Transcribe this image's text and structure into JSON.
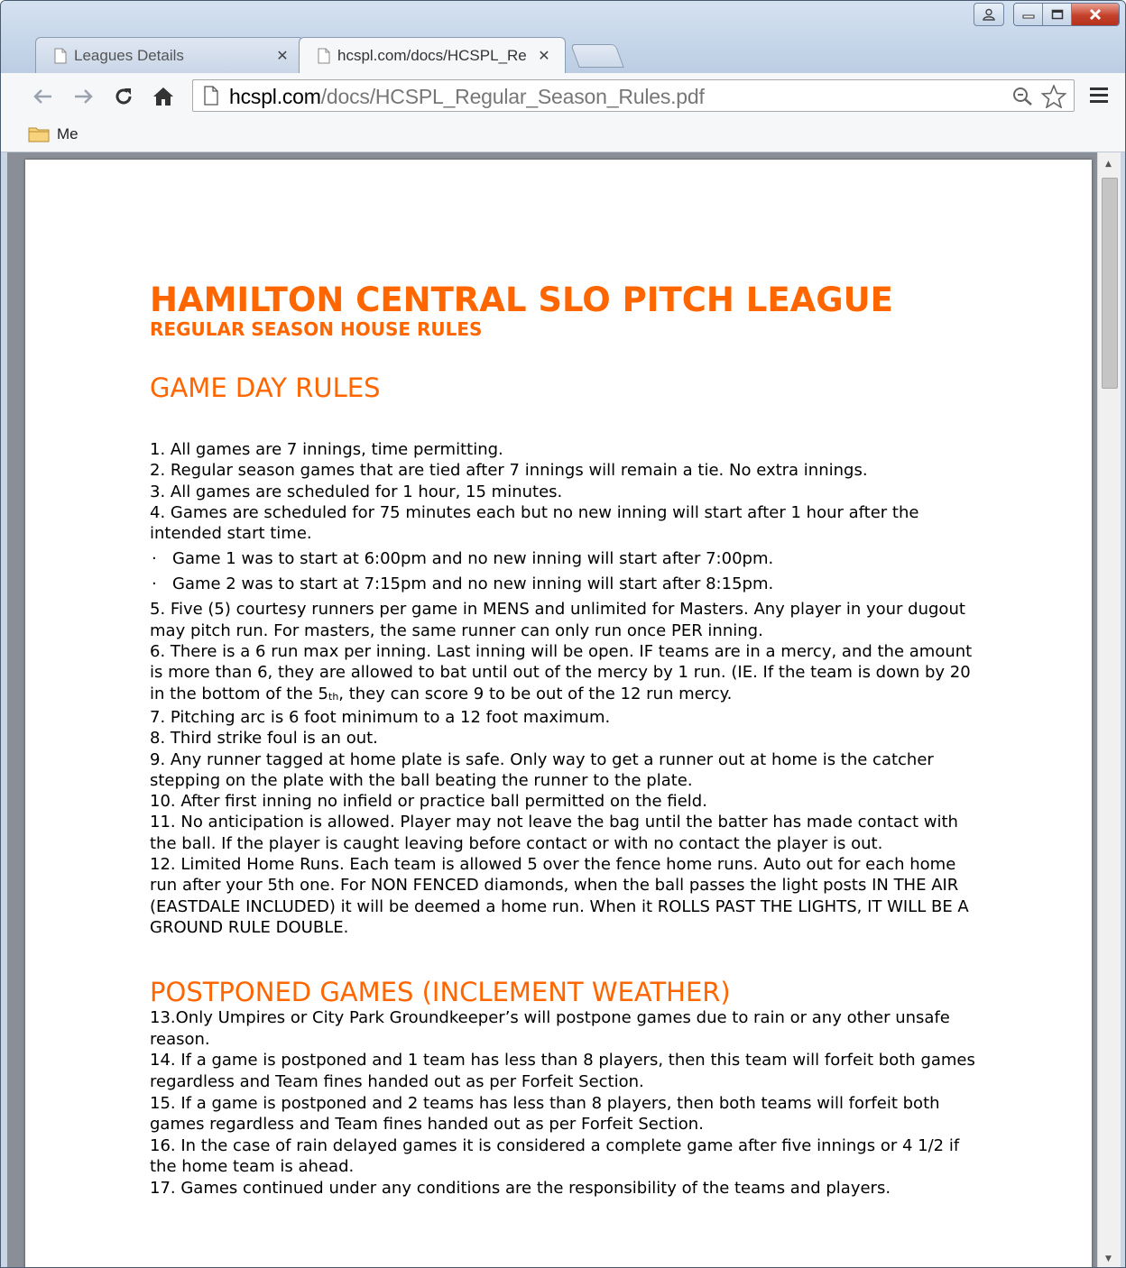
{
  "browser": {
    "tabs": [
      {
        "title": "Leagues Details",
        "active": false
      },
      {
        "title": "hcspl.com/docs/HCSPL_Re",
        "active": true
      }
    ],
    "url_host": "hcspl.com",
    "url_path": "/docs/HCSPL_Regular_Season_Rules.pdf",
    "bookmarks": [
      {
        "label": "Me"
      }
    ]
  },
  "document": {
    "title": "HAMILTON CENTRAL SLO PITCH LEAGUE",
    "subtitle": "REGULAR SEASON HOUSE RULES",
    "section1_heading": "GAME DAY RULES",
    "rules": {
      "r1": "1. All games are 7 innings, time permitting.",
      "r2": "2. Regular season games that are tied after 7 innings will remain a tie. No extra innings.",
      "r3": "3. All games are scheduled for 1 hour, 15 minutes.",
      "r4": "4. Games are scheduled for 75 minutes each but no new inning will start after 1 hour after the intended start time.",
      "b1": "Game 1 was to start at 6:00pm and no new inning will start after 7:00pm.",
      "b2": "Game 2 was to start at 7:15pm and no new inning will start after 8:15pm.",
      "r5": "5. Five (5) courtesy runners per game in MENS and unlimited for Masters. Any player in your dugout may pitch run.  For masters, the same runner can only run once PER inning.",
      "r6a": "6. There is a 6 run max per inning. Last inning will be open. IF teams are in a mercy, and the amount is more than 6, they are allowed to bat until out of the mercy by 1 run. (IE. If the team is down by 20 in the bottom of the 5",
      "r6sup": "th",
      "r6b": ", they can score 9 to be out of the 12 run mercy.",
      "r7": "7. Pitching arc is 6 foot minimum to a 12 foot maximum.",
      "r8": "8. Third strike foul is an out.",
      "r9": "9. Any runner tagged at home plate is safe. Only way to get a runner out at home is the catcher stepping on the plate with the ball beating the runner to the plate.",
      "r10": "10. After first inning no infield or practice ball permitted on the field.",
      "r11": "11. No anticipation is allowed. Player may not leave the bag until the batter has made contact with the ball. If the player is caught leaving before contact or with no contact the player is out.",
      "r12": "12. Limited Home Runs. Each team is allowed 5 over the fence home runs. Auto out for each home run after your 5th one. For NON FENCED diamonds, when the ball passes the light posts IN THE AIR\n(EASTDALE INCLUDED) it will be deemed a home run. When it ROLLS PAST THE LIGHTS, IT WILL BE A GROUND RULE DOUBLE."
    },
    "section2_heading": "POSTPONED GAMES (INCLEMENT WEATHER)",
    "rules2": {
      "r13": "13.Only Umpires or City Park Groundkeeper’s will postpone games due to rain or any other unsafe reason.",
      "r14": "14. If a game is postponed and 1 team has less than 8 players, then this team will forfeit both games regardless and Team fines handed out as per Forfeit Section.",
      "r15": "15. If a game is postponed and 2 teams has less than 8 players, then both teams will forfeit both games regardless and Team fines handed out as per Forfeit Section.",
      "r16": "16. In the case of rain delayed games it is considered a complete game after five innings or 4 1/2 if the home team is ahead.",
      "r17": "17. Games continued under any conditions are the responsibility of the teams and players."
    }
  }
}
